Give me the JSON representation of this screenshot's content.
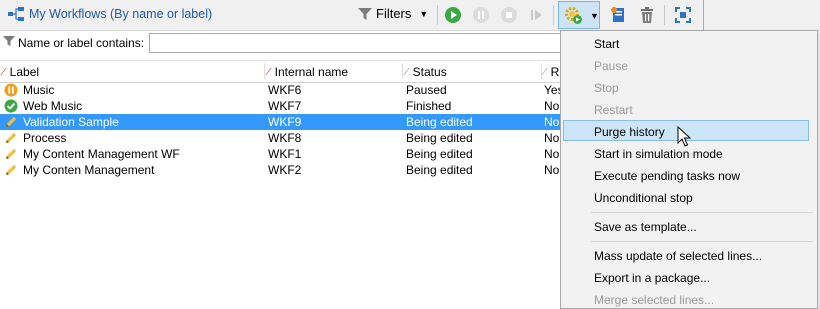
{
  "toolbar": {
    "title": "My Workflows (By name or label)",
    "filters_label": "Filters"
  },
  "filter": {
    "label": "Name or label contains:",
    "value": ""
  },
  "grid": {
    "columns": [
      "Label",
      "Internal name",
      "Status",
      "R"
    ],
    "rows": [
      {
        "icon": "paused-icon",
        "label": "Music",
        "internal": "WKF6",
        "status": "Paused",
        "extra": "Yes",
        "selected": false
      },
      {
        "icon": "finished-icon",
        "label": "Web Music",
        "internal": "WKF7",
        "status": "Finished",
        "extra": "No",
        "selected": false
      },
      {
        "icon": "pencil-icon",
        "label": "Validation Sample",
        "internal": "WKF9",
        "status": "Being edited",
        "extra": "No",
        "selected": true
      },
      {
        "icon": "pencil-icon",
        "label": "Process",
        "internal": "WKF8",
        "status": "Being edited",
        "extra": "No",
        "selected": false
      },
      {
        "icon": "pencil-icon",
        "label": "My Content Management WF",
        "internal": "WKF1",
        "status": "Being edited",
        "extra": "No",
        "selected": false
      },
      {
        "icon": "pencil-icon",
        "label": "My Conten Management",
        "internal": "WKF2",
        "status": "Being edited",
        "extra": "No",
        "selected": false
      }
    ]
  },
  "menu": {
    "items": [
      {
        "label": "Start",
        "enabled": true
      },
      {
        "label": "Pause",
        "enabled": false
      },
      {
        "label": "Stop",
        "enabled": false
      },
      {
        "label": "Restart",
        "enabled": false
      },
      {
        "label": "Purge history",
        "enabled": true,
        "highlighted": true
      },
      {
        "label": "Start in simulation mode",
        "enabled": true
      },
      {
        "label": "Execute pending tasks now",
        "enabled": true
      },
      {
        "label": "Unconditional stop",
        "enabled": true
      },
      {
        "label": "Save as template...",
        "enabled": true
      },
      {
        "label": "Mass update of selected lines...",
        "enabled": true
      },
      {
        "label": "Export in a package...",
        "enabled": true
      },
      {
        "label": "Merge selected lines...",
        "enabled": false
      }
    ]
  },
  "colors": {
    "selection": "#3399ff",
    "title_link": "#1e5ba8",
    "play_green": "#3aa845",
    "menu_highlight": "#cce5f7"
  }
}
